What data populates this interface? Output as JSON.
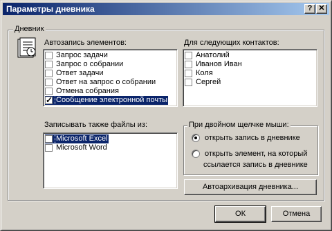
{
  "window": {
    "title": "Параметры дневника",
    "help_button": "?",
    "close_button": "✕"
  },
  "group": {
    "label": "Дневник"
  },
  "autorecord": {
    "label": "Автозапись элементов:",
    "items": [
      {
        "label": "Запрос задачи",
        "checked": false
      },
      {
        "label": "Запрос о собрании",
        "checked": false
      },
      {
        "label": "Ответ задачи",
        "checked": false
      },
      {
        "label": "Ответ на запрос о собрании",
        "checked": false
      },
      {
        "label": "Отмена собрания",
        "checked": false
      },
      {
        "label": "Сообщение электронной почты",
        "checked": true,
        "selected": true
      }
    ]
  },
  "contacts": {
    "label": "Для следующих контактов:",
    "items": [
      {
        "label": "Анатолий",
        "checked": false
      },
      {
        "label": "Иванов Иван",
        "checked": false
      },
      {
        "label": "Коля",
        "checked": false
      },
      {
        "label": "Сергей",
        "checked": false
      }
    ]
  },
  "files": {
    "label": "Записывать также файлы из:",
    "items": [
      {
        "label": "Microsoft Excel",
        "checked": false,
        "selected": true
      },
      {
        "label": "Microsoft Word",
        "checked": false
      }
    ]
  },
  "doubleclick": {
    "label": "При двойном щелчке мыши:",
    "option1": "открыть запись в дневнике",
    "option2_line1": "открыть элемент, на который",
    "option2_line2": "ссылается запись в дневнике",
    "selected": 1
  },
  "buttons": {
    "archive": "Автоархивация дневника...",
    "ok": "ОК",
    "cancel": "Отмена"
  }
}
